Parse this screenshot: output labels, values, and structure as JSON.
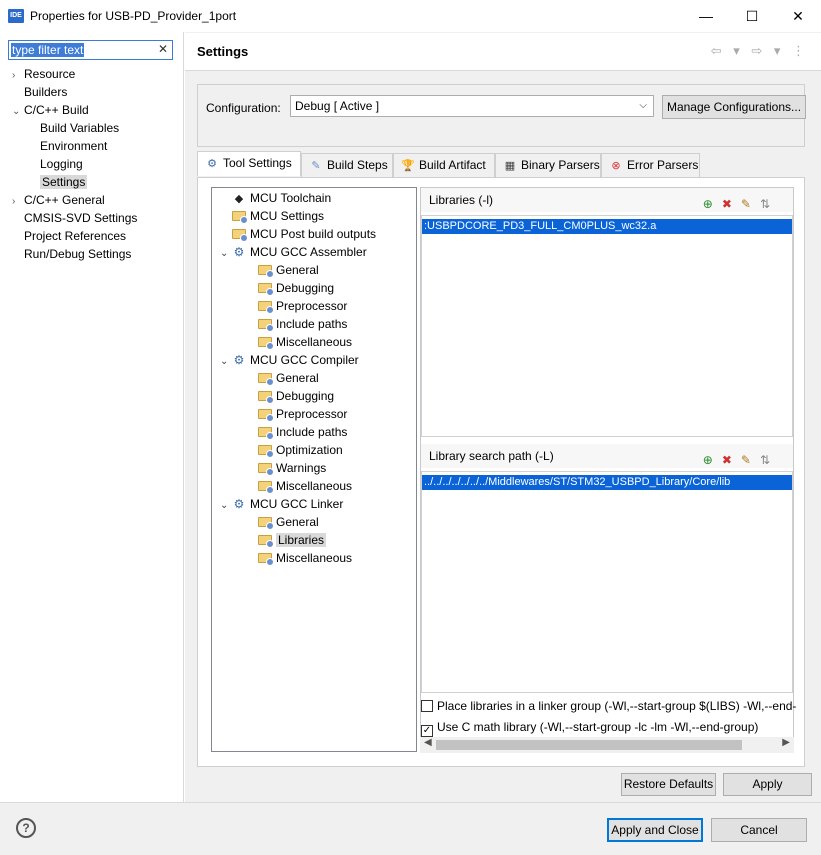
{
  "window": {
    "app_icon": "IDE",
    "title": "Properties for USB-PD_Provider_1port",
    "minimize": "—",
    "maximize": "☐",
    "close": "✕"
  },
  "filter": {
    "value": "type filter text",
    "clear": "✕"
  },
  "sidebar": {
    "items": [
      {
        "label": "Resource",
        "toggle": "›",
        "level": 0
      },
      {
        "label": "Builders",
        "toggle": "",
        "level": 0
      },
      {
        "label": "C/C++ Build",
        "toggle": "⌄",
        "level": 0
      },
      {
        "label": "Build Variables",
        "toggle": "",
        "level": 1
      },
      {
        "label": "Environment",
        "toggle": "",
        "level": 1
      },
      {
        "label": "Logging",
        "toggle": "",
        "level": 1
      },
      {
        "label": "Settings",
        "toggle": "",
        "level": 1,
        "selected": true
      },
      {
        "label": "C/C++ General",
        "toggle": "›",
        "level": 0
      },
      {
        "label": "CMSIS-SVD Settings",
        "toggle": "",
        "level": 0
      },
      {
        "label": "Project References",
        "toggle": "",
        "level": 0
      },
      {
        "label": "Run/Debug Settings",
        "toggle": "",
        "level": 0
      }
    ]
  },
  "header": {
    "title": "Settings",
    "nav": "⇦ ▾ ⇨ ▾ ⋮"
  },
  "configuration": {
    "label": "Configuration:",
    "value": "Debug  [ Active ]",
    "manage_label": "Manage Configurations..."
  },
  "tabs": [
    {
      "label": "Tool Settings",
      "icon": "⚙",
      "active": true
    },
    {
      "label": "Build Steps",
      "icon": "✎"
    },
    {
      "label": "Build Artifact",
      "icon": "🏆"
    },
    {
      "label": "Binary Parsers",
      "icon": "▦"
    },
    {
      "label": "Error Parsers",
      "icon": "⊗"
    }
  ],
  "tool_tree": [
    {
      "label": "MCU Toolchain",
      "kind": "chip",
      "level": 0
    },
    {
      "label": "MCU Settings",
      "kind": "folder",
      "level": 0
    },
    {
      "label": "MCU Post build outputs",
      "kind": "folder",
      "level": 0
    },
    {
      "label": "MCU GCC Assembler",
      "kind": "gear",
      "level": 0,
      "expanded": true
    },
    {
      "label": "General",
      "kind": "folder",
      "level": 1
    },
    {
      "label": "Debugging",
      "kind": "folder",
      "level": 1
    },
    {
      "label": "Preprocessor",
      "kind": "folder",
      "level": 1
    },
    {
      "label": "Include paths",
      "kind": "folder",
      "level": 1
    },
    {
      "label": "Miscellaneous",
      "kind": "folder",
      "level": 1
    },
    {
      "label": "MCU GCC Compiler",
      "kind": "gear",
      "level": 0,
      "expanded": true
    },
    {
      "label": "General",
      "kind": "folder",
      "level": 1
    },
    {
      "label": "Debugging",
      "kind": "folder",
      "level": 1
    },
    {
      "label": "Preprocessor",
      "kind": "folder",
      "level": 1
    },
    {
      "label": "Include paths",
      "kind": "folder",
      "level": 1
    },
    {
      "label": "Optimization",
      "kind": "folder",
      "level": 1
    },
    {
      "label": "Warnings",
      "kind": "folder",
      "level": 1
    },
    {
      "label": "Miscellaneous",
      "kind": "folder",
      "level": 1
    },
    {
      "label": "MCU GCC Linker",
      "kind": "gear",
      "level": 0,
      "expanded": true
    },
    {
      "label": "General",
      "kind": "folder",
      "level": 1
    },
    {
      "label": "Libraries",
      "kind": "folder",
      "level": 1,
      "selected": true
    },
    {
      "label": "Miscellaneous",
      "kind": "folder",
      "level": 1
    }
  ],
  "libraries": {
    "header": "Libraries (-l)",
    "items": [
      ":USBPDCORE_PD3_FULL_CM0PLUS_wc32.a"
    ]
  },
  "library_search_path": {
    "header": "Library search path (-L)",
    "items": [
      "../../../../../../../Middlewares/ST/STM32_USBPD_Library/Core/lib"
    ]
  },
  "list_actions": {
    "add": "⊕",
    "delete": "✖",
    "edit": "✎",
    "more": "⇅"
  },
  "options": [
    {
      "label": "Place libraries in a linker group (-Wl,--start-group $(LIBS) -Wl,--end-",
      "checked": false
    },
    {
      "label": "Use C math library (-Wl,--start-group -lc -lm -Wl,--end-group)",
      "checked": true
    }
  ],
  "buttons": {
    "restore_defaults": "Restore Defaults",
    "apply": "Apply",
    "apply_and_close": "Apply and Close",
    "cancel": "Cancel",
    "help": "?"
  },
  "colors": {
    "selection": "#0a64d8",
    "default_button_border": "#0078d7",
    "panel_bg": "#f0f0f0"
  }
}
